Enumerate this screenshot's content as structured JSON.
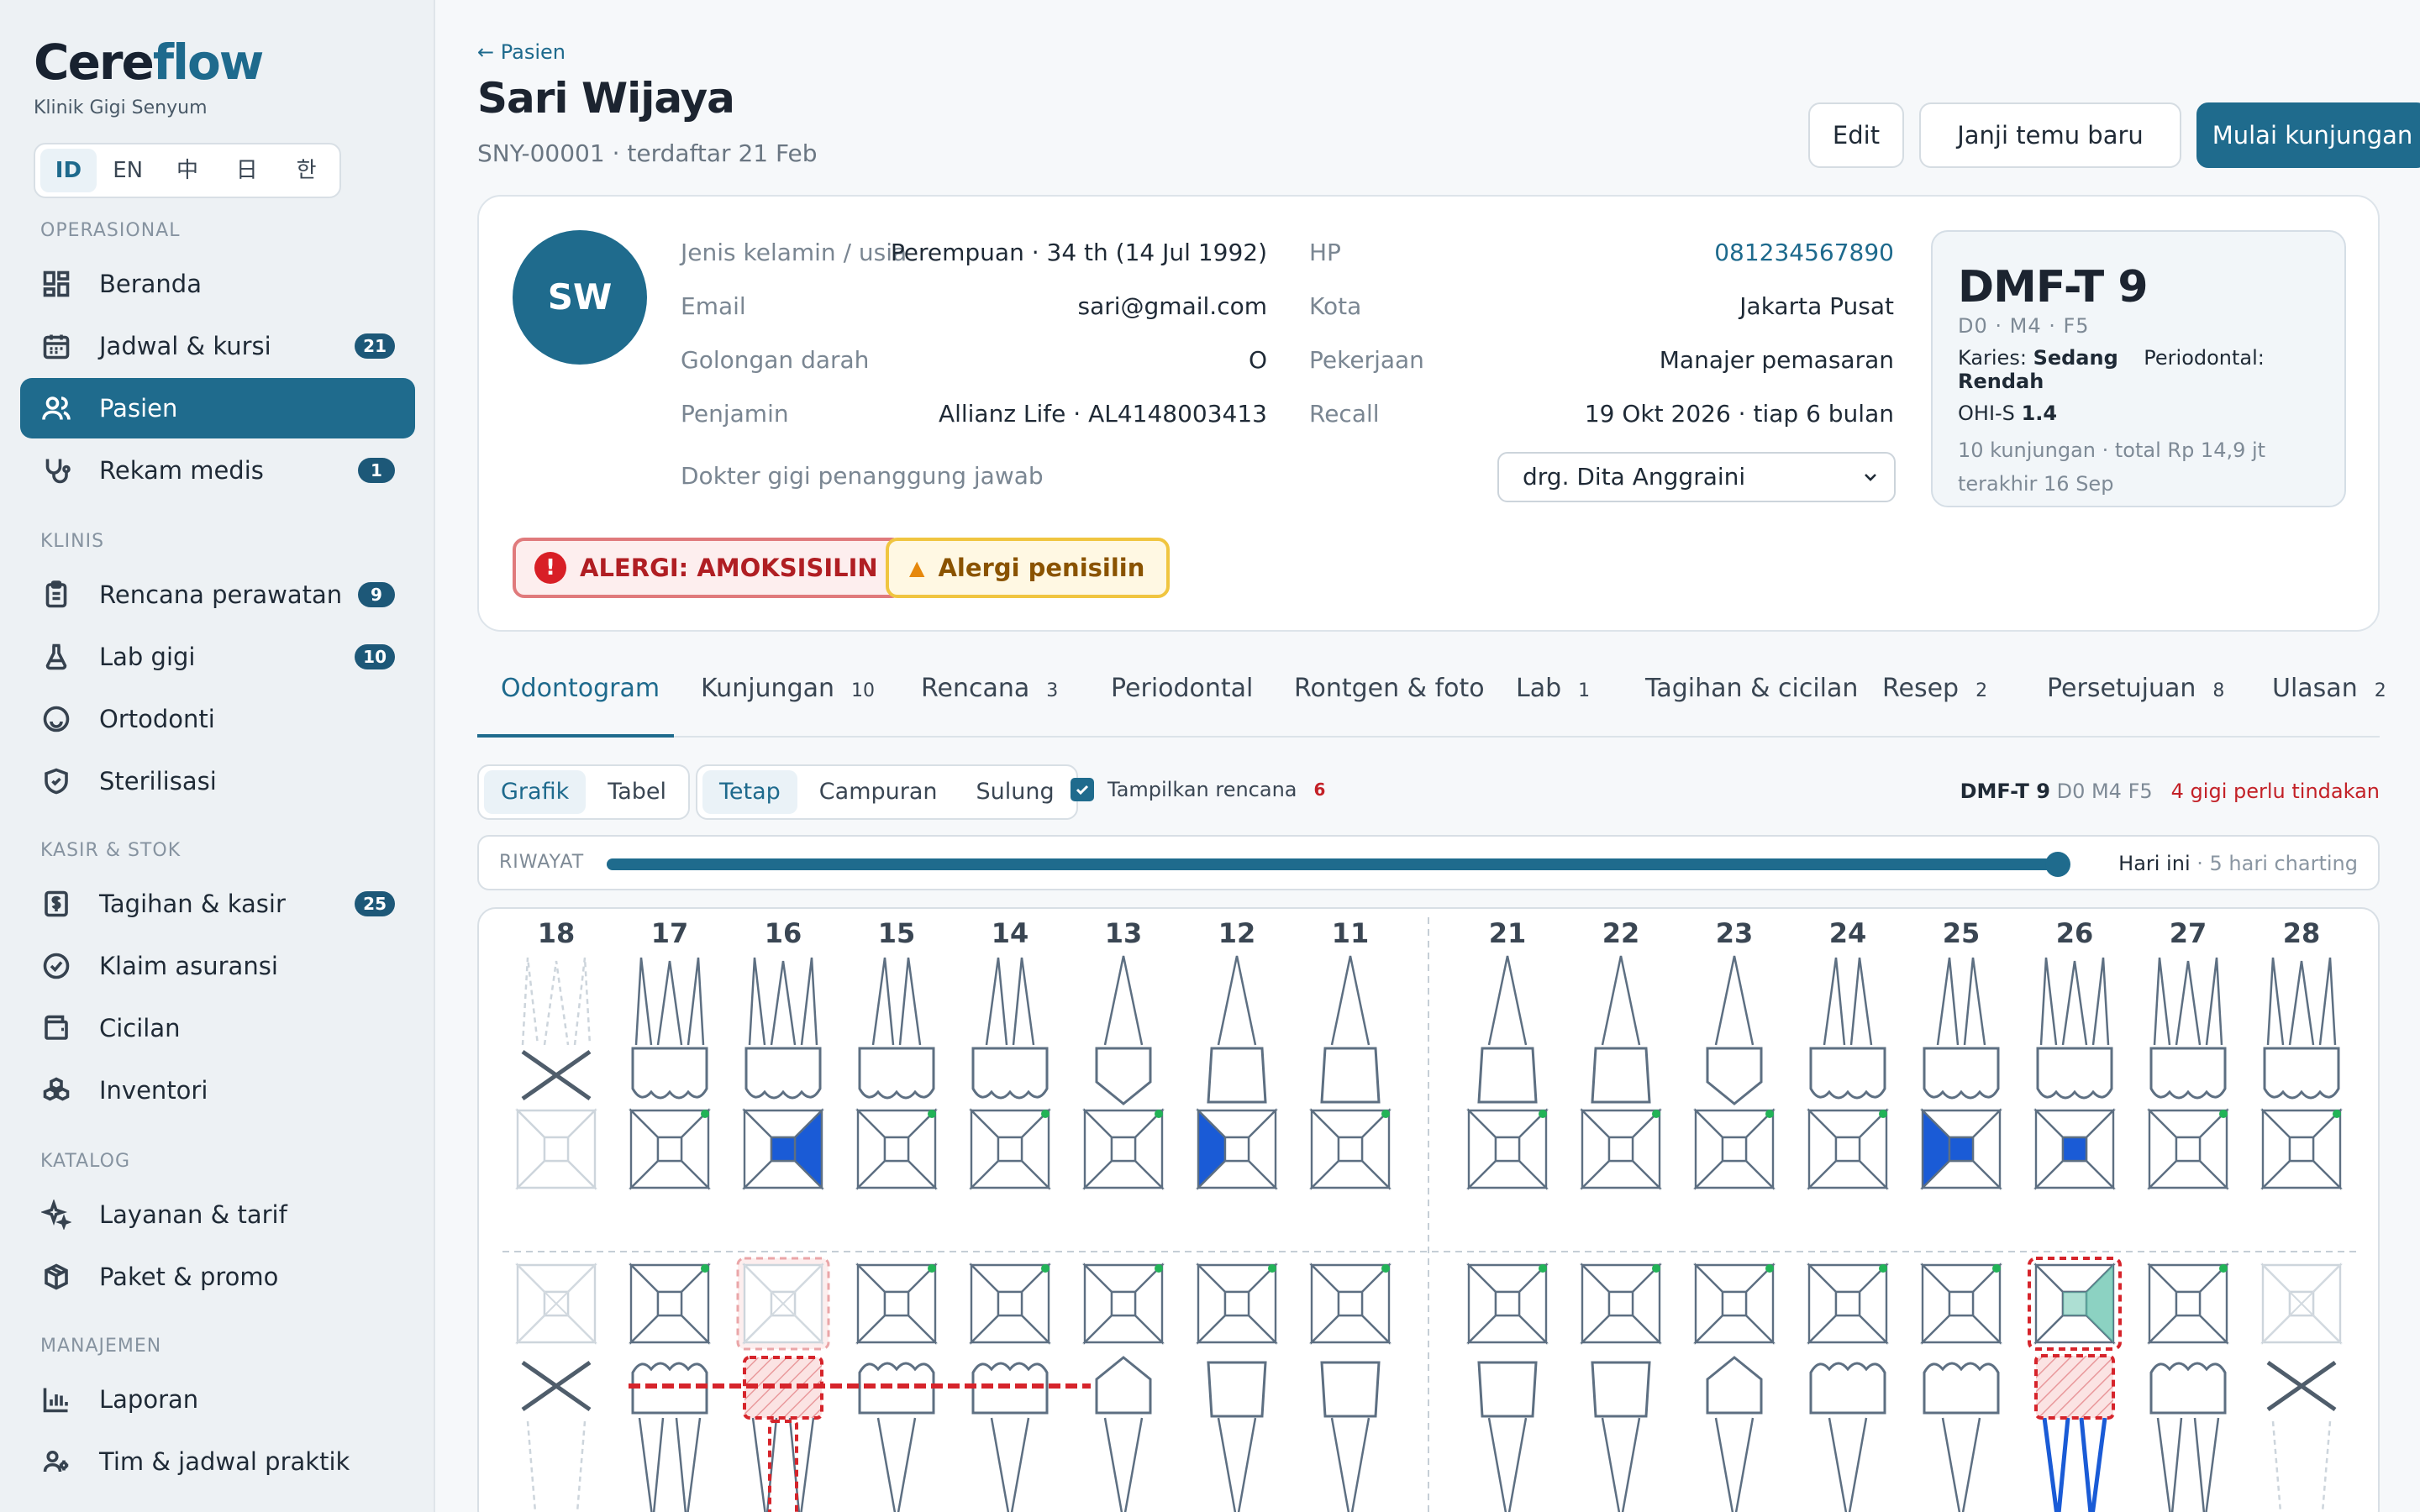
{
  "brand": {
    "name_a": "Cere",
    "name_b": "flow",
    "clinic": "Klinik Gigi Senyum"
  },
  "languages": [
    "ID",
    "EN",
    "中",
    "日",
    "한"
  ],
  "sidebar": {
    "sections": [
      "OPERASIONAL",
      "KLINIS",
      "KASIR & STOK",
      "KATALOG",
      "MANAJEMEN"
    ],
    "items": [
      {
        "label": "Beranda",
        "icon": "grid-icon",
        "badge": ""
      },
      {
        "label": "Jadwal & kursi",
        "icon": "calendar-icon",
        "badge": "21"
      },
      {
        "label": "Pasien",
        "icon": "users-icon",
        "badge": ""
      },
      {
        "label": "Rekam medis",
        "icon": "stethoscope-icon",
        "badge": "1"
      },
      {
        "label": "Rencana perawatan",
        "icon": "clipboard-icon",
        "badge": "9"
      },
      {
        "label": "Lab gigi",
        "icon": "flask-icon",
        "badge": "10"
      },
      {
        "label": "Ortodonti",
        "icon": "smile-icon",
        "badge": ""
      },
      {
        "label": "Sterilisasi",
        "icon": "shield-icon",
        "badge": ""
      },
      {
        "label": "Tagihan & kasir",
        "icon": "dollar-icon",
        "badge": "25"
      },
      {
        "label": "Klaim asuransi",
        "icon": "check-circle-icon",
        "badge": ""
      },
      {
        "label": "Cicilan",
        "icon": "wallet-icon",
        "badge": ""
      },
      {
        "label": "Inventori",
        "icon": "boxes-icon",
        "badge": ""
      },
      {
        "label": "Layanan & tarif",
        "icon": "sparkle-icon",
        "badge": ""
      },
      {
        "label": "Paket & promo",
        "icon": "package-icon",
        "badge": ""
      },
      {
        "label": "Laporan",
        "icon": "bar-chart-icon",
        "badge": ""
      },
      {
        "label": "Tim & jadwal praktik",
        "icon": "team-icon",
        "badge": ""
      }
    ]
  },
  "header": {
    "back": "← Pasien",
    "name": "Sari Wijaya",
    "meta": "SNY-00001 · terdaftar 21 Feb",
    "btn_edit": "Edit",
    "btn_appt": "Janji temu baru",
    "btn_start": "Mulai kunjungan"
  },
  "patient": {
    "initials": "SW",
    "fields_left": [
      {
        "label": "Jenis kelamin / usia",
        "value": "Perempuan · 34 th (14 Jul 1992)"
      },
      {
        "label": "Email",
        "value": "sari@gmail.com"
      },
      {
        "label": "Golongan darah",
        "value": "O"
      },
      {
        "label": "Penjamin",
        "value": "Allianz Life · AL4148003413"
      }
    ],
    "fields_right": [
      {
        "label": "HP",
        "value": "081234567890"
      },
      {
        "label": "Kota",
        "value": "Jakarta Pusat"
      },
      {
        "label": "Pekerjaan",
        "value": "Manajer pemasaran"
      },
      {
        "label": "Recall",
        "value": "19 Okt 2026 · tiap 6 bulan"
      }
    ],
    "dentist_label": "Dokter gigi penanggung jawab",
    "dentist_value": "drg. Dita Anggraini",
    "alert_allergy": "ALERGI: AMOKSISILIN",
    "alert_warn": "Alergi penisilin"
  },
  "dmf": {
    "title": "DMF-T 9",
    "sub": "D0 · M4 · F5",
    "caries_label": "Karies:",
    "caries_value": "Sedang",
    "perio_label": "Periodontal:",
    "perio_value": "Rendah",
    "ohi_label": "OHI-S",
    "ohi_value": "1.4",
    "visits": "10 kunjungan · total Rp 14,9 jt",
    "last": "terakhir 16 Sep"
  },
  "tabs": [
    {
      "label": "Odontogram",
      "count": ""
    },
    {
      "label": "Kunjungan",
      "count": "10"
    },
    {
      "label": "Rencana",
      "count": "3"
    },
    {
      "label": "Periodontal",
      "count": ""
    },
    {
      "label": "Rontgen & foto",
      "count": ""
    },
    {
      "label": "Lab",
      "count": "1"
    },
    {
      "label": "Tagihan & cicilan",
      "count": ""
    },
    {
      "label": "Resep",
      "count": "2"
    },
    {
      "label": "Persetujuan",
      "count": "8"
    },
    {
      "label": "Ulasan",
      "count": "2"
    }
  ],
  "view": {
    "mode": [
      "Grafik",
      "Tabel"
    ],
    "dentition": [
      "Tetap",
      "Campuran",
      "Sulung"
    ],
    "show_plan": "Tampilkan rencana",
    "plan_count": "6",
    "sum_title": "DMF-T 9",
    "sum_detail": "D0 M4 F5",
    "sum_action": "4 gigi perlu tindakan"
  },
  "history": {
    "label": "RIWAYAT",
    "today": "Hari ini",
    "charting": "· 5 hari charting",
    "position": 1.0
  },
  "teeth_upper": [
    "18",
    "17",
    "16",
    "15",
    "14",
    "13",
    "12",
    "11",
    "21",
    "22",
    "23",
    "24",
    "25",
    "26",
    "27",
    "28"
  ],
  "colors": {
    "accent": "#1f6b8d",
    "filling": "#1a5bd6",
    "missing": "#4f5d6b",
    "plan": "#d6242b",
    "sealant": "#5bbfa8"
  }
}
